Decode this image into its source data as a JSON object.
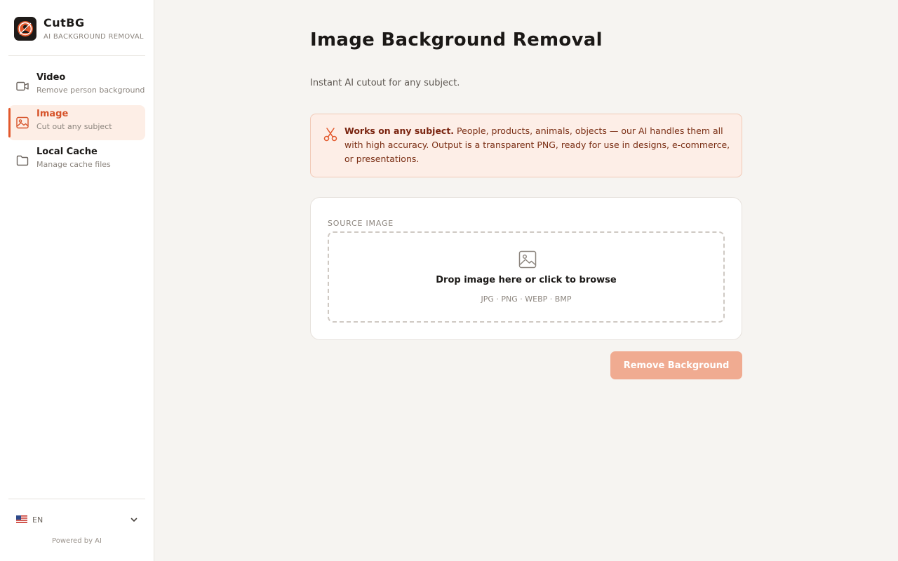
{
  "brand": {
    "name": "CutBG",
    "subtitle": "AI BACKGROUND REMOVAL",
    "logo_icon": "cutbg-logo-icon"
  },
  "nav": [
    {
      "title": "Video",
      "subtitle": "Remove person background",
      "icon": "video-icon",
      "active": false
    },
    {
      "title": "Image",
      "subtitle": "Cut out any subject",
      "icon": "image-icon",
      "active": true
    },
    {
      "title": "Local Cache",
      "subtitle": "Manage cache files",
      "icon": "folder-icon",
      "active": false
    }
  ],
  "language": {
    "flag": "us-flag-icon",
    "code": "EN"
  },
  "footer": {
    "powered": "Powered by AI"
  },
  "page": {
    "title": "Image Background Removal",
    "subtitle": "Instant AI cutout for any subject."
  },
  "notice": {
    "icon": "scissors-icon",
    "bold": "Works on any subject.",
    "text": " People, products, animals, objects — our AI handles them all with high accuracy. Output is a transparent PNG, ready for use in designs, e-commerce, or presentations."
  },
  "source": {
    "label": "SOURCE IMAGE",
    "drop_title": "Drop image here or click to browse",
    "formats": "JPG · PNG · WEBP · BMP"
  },
  "action": {
    "label": "Remove Background",
    "enabled": false
  },
  "colors": {
    "accent": "#e2582c",
    "accent_light": "#fdeee6",
    "button_disabled": "#f0ab91",
    "background": "#f6f4f1"
  }
}
